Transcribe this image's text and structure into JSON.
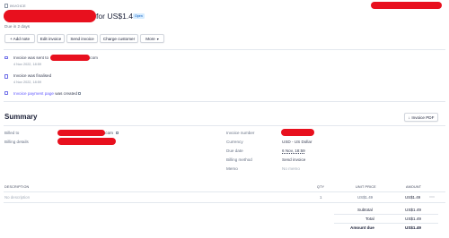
{
  "header": {
    "section_label": "INVOICE",
    "amount_text": "for US$1.49",
    "status_badge": "Open",
    "due_text": "Due in 2 days"
  },
  "toolbar": {
    "add_note": "+ Add note",
    "edit_invoice": "Edit invoice",
    "send_invoice": "Send invoice",
    "charge_customer": "Charge customer",
    "more": "More"
  },
  "timeline": [
    {
      "text_prefix": "Invoice was sent to",
      "text_suffix": ".com",
      "time": "4 Nov 2022, 18:59"
    },
    {
      "text": "Invoice was finalised",
      "time": "4 Nov 2022, 18:59"
    },
    {
      "link": "Invoice payment page",
      "text": "was created"
    }
  ],
  "summary": {
    "title": "Summary",
    "pdf_button": "Invoice PDF",
    "billed_to_label": "Billed to",
    "billed_to_suffix": ".com",
    "billing_details_label": "Billing details",
    "invoice_number_label": "Invoice number",
    "currency_label": "Currency",
    "currency_value": "USD - US Dollar",
    "due_date_label": "Due date",
    "due_date_value": "6 Nov, 18:59",
    "billing_method_label": "Billing method",
    "billing_method_value": "Send invoice",
    "memo_label": "Memo",
    "memo_value": "No memo"
  },
  "line_items": {
    "headers": {
      "description": "DESCRIPTION",
      "qty": "QTY",
      "unit_price": "UNIT PRICE",
      "amount": "AMOUNT"
    },
    "rows": [
      {
        "description": "No description",
        "qty": "1",
        "unit_price": "US$1.49",
        "amount": "US$1.49"
      }
    ],
    "more_icon": "more-horizontal-icon"
  },
  "totals": {
    "subtotal_label": "Subtotal",
    "subtotal_value": "US$1.49",
    "total_label": "Total",
    "total_value": "US$1.49",
    "amount_due_label": "Amount due",
    "amount_due_value": "US$1.49"
  },
  "colors": {
    "accent": "#635bff",
    "badge_bg": "#d6ecff",
    "badge_text": "#0055bc",
    "redaction": "#e8101e"
  }
}
